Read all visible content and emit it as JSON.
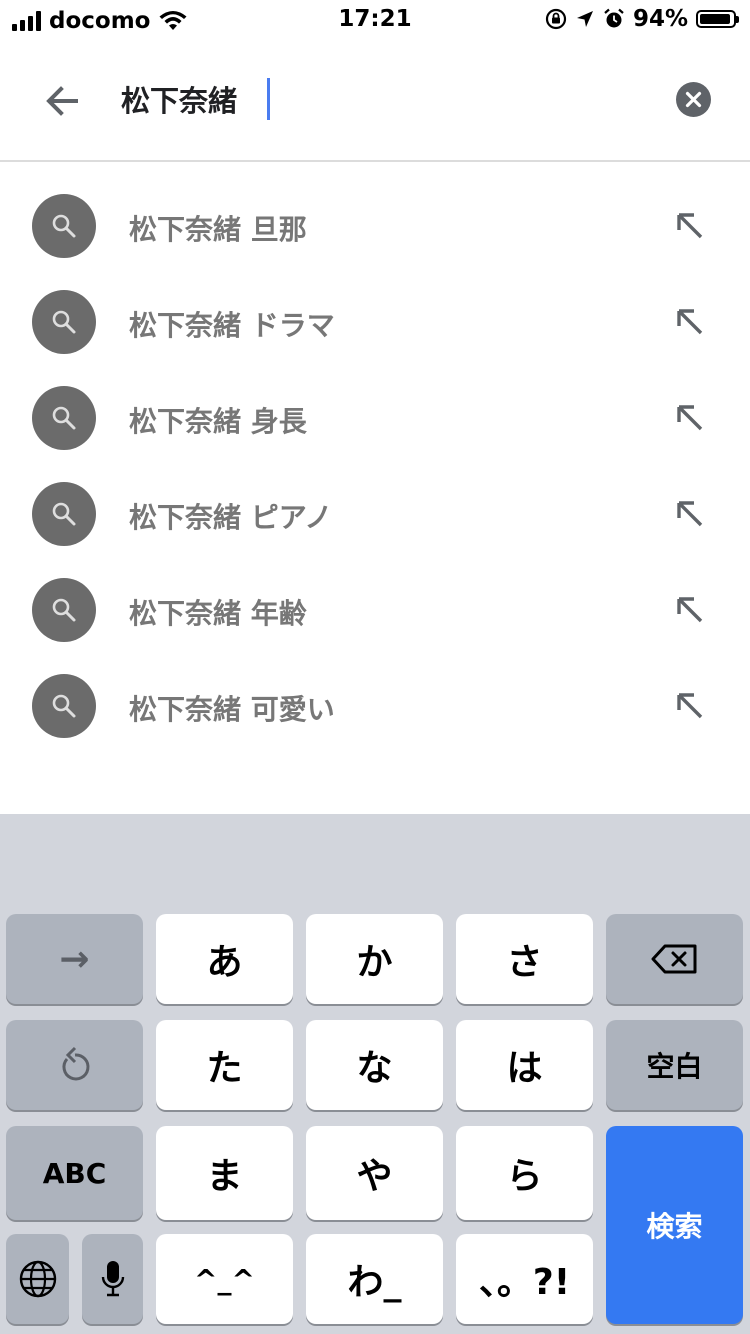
{
  "status_bar": {
    "carrier": "docomo",
    "time": "17:21",
    "battery_percent": "94%",
    "battery_level": 0.94
  },
  "search": {
    "query": "松下奈緒"
  },
  "suggestions": [
    {
      "text": "松下奈緒 旦那"
    },
    {
      "text": "松下奈緒 ドラマ"
    },
    {
      "text": "松下奈緒 身長"
    },
    {
      "text": "松下奈緒 ピアノ"
    },
    {
      "text": "松下奈緒 年齢"
    },
    {
      "text": "松下奈緒 可愛い"
    }
  ],
  "keyboard": {
    "arrow_label": "→",
    "row1": [
      "あ",
      "か",
      "さ"
    ],
    "row2": [
      "た",
      "な",
      "は"
    ],
    "row3": [
      "ま",
      "や",
      "ら"
    ],
    "row4": [
      "^_^",
      "わ_",
      "、。?!"
    ],
    "space_label": "空白",
    "abc_label": "ABC",
    "search_label": "検索"
  },
  "colors": {
    "accent": "#3479f2",
    "caret": "#4a7cf0",
    "keyboard_bg": "#d2d5dc",
    "icon_circle": "#6b6b6b"
  }
}
